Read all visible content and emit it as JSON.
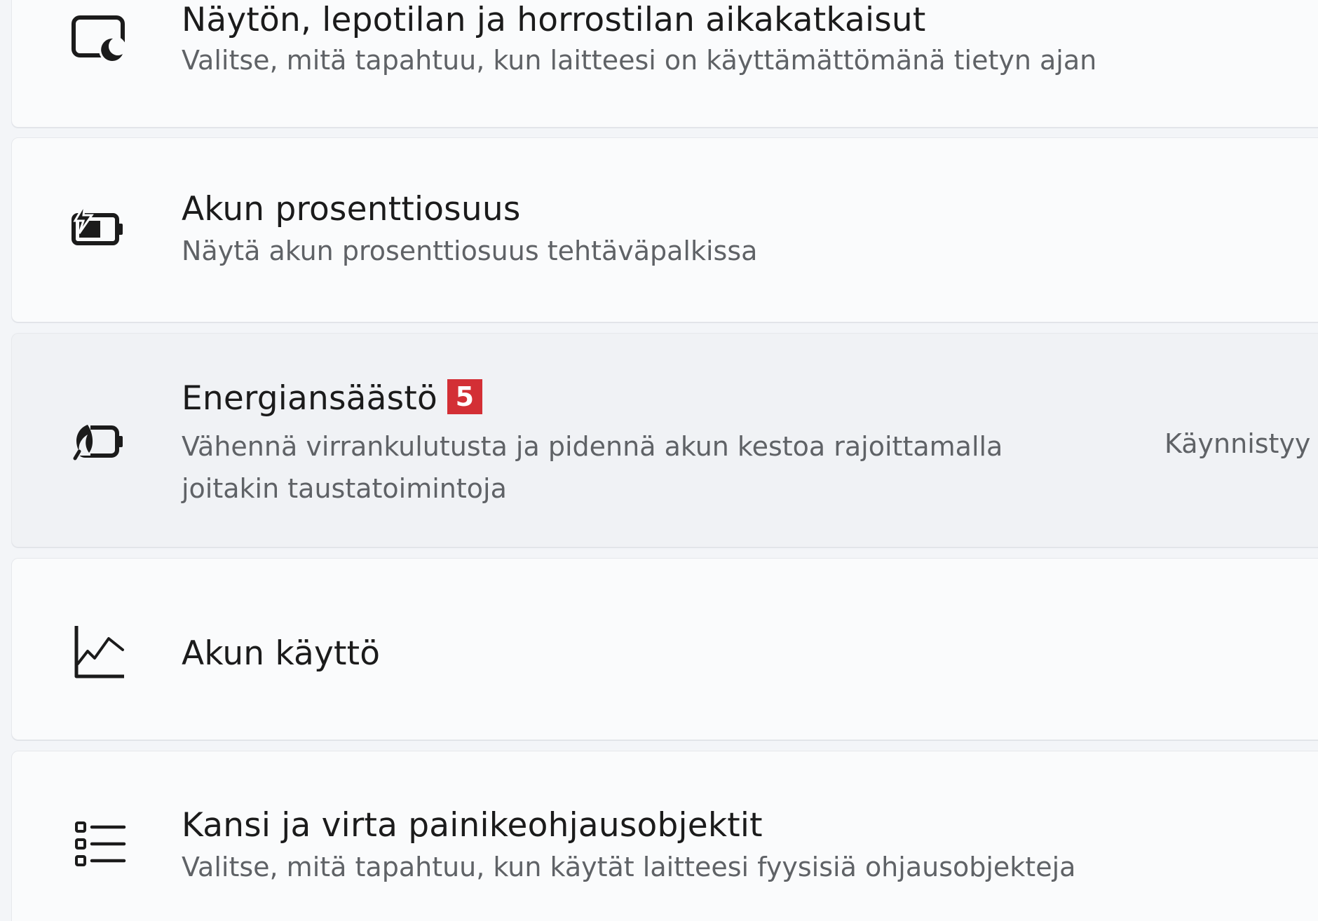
{
  "rows": [
    {
      "title": "Näytön, lepotilan ja horrostilan aikakatkaisut",
      "description": "Valitse, mitä tapahtuu, kun laitteesi on käyttämättömänä tietyn ajan",
      "icon": "screen-sleep-icon"
    },
    {
      "title": "Akun prosenttiosuus",
      "description": "Näytä akun prosenttiosuus tehtäväpalkissa",
      "icon": "battery-charging-icon"
    },
    {
      "title": "Energiansäästö",
      "badge": "5",
      "description_line1": "Vähennä virrankulutusta ja pidennä akun kestoa rajoittamalla",
      "description_line2": "joitakin taustatoimintoja",
      "status": "Käynnistyy",
      "icon": "energy-saver-icon"
    },
    {
      "title": "Akun käyttö",
      "icon": "chart-line-icon"
    },
    {
      "title": "Kansi ja virta painikeohjausobjektit",
      "description": "Valitse, mitä tapahtuu, kun käytät laitteesi fyysisiä ohjausobjekteja",
      "icon": "list-icon"
    }
  ],
  "colors": {
    "page_background": "#f3f5f8",
    "card_background": "#fafbfc",
    "card_hover_background": "#f0f2f5",
    "badge_background": "#d32f35",
    "text_primary": "#1b1b1b",
    "text_secondary": "#5f6266"
  }
}
